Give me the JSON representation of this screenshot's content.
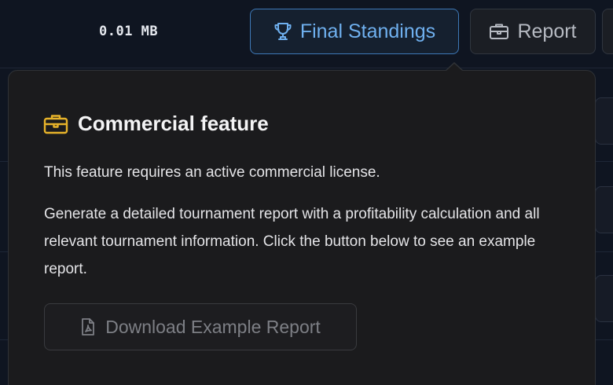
{
  "toolbar": {
    "file_size": "0.01 MB",
    "final_standings_label": "Final Standings",
    "report_label": "Report"
  },
  "popover": {
    "title": "Commercial feature",
    "license_notice": "This feature requires an active commercial license.",
    "description": "Generate a detailed tournament report with a profitability calculation and all relevant tournament information. Click the button below to see an example report.",
    "download_button_label": "Download Example Report"
  },
  "icons": {
    "final_standings": "trophy-icon",
    "report": "briefcase-icon",
    "title": "briefcase-icon",
    "download": "pdf-file-icon"
  },
  "colors": {
    "accent_blue": "#6fb0ef",
    "commercial_gold": "#e7b32a",
    "popover_bg": "#1b1b1d",
    "page_bg": "#0f1521"
  }
}
